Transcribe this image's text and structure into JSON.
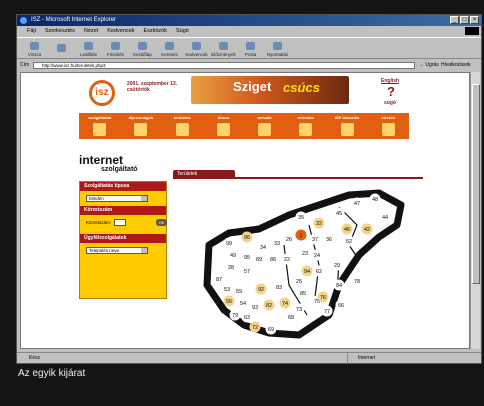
{
  "window": {
    "title": "ISZ - Microsoft Internet Explorer"
  },
  "menu": [
    "Fájl",
    "Szerkesztés",
    "Nézet",
    "Kedvencek",
    "Eszközök",
    "Súgó"
  ],
  "toolbar": [
    "Vissza",
    "",
    "Leállítás",
    "Frissítés",
    "Kezdőlap",
    "Keresés",
    "Kedvencek",
    "Előzmények",
    "Posta",
    "Nyomtatás"
  ],
  "address": {
    "label": "Cím",
    "value": "http://www.isz.hu/teruletek.php3",
    "go": "Ugrás",
    "links": "Hivatkozások"
  },
  "status": {
    "left": "Kész",
    "zone": "Internet"
  },
  "page": {
    "logo": "isz",
    "date_line1": "2001. szeptember 13.",
    "date_line2": "csütörtök",
    "banner_a": "Sziget",
    "banner_b": "csúcs",
    "english": "English",
    "help_mark": "?",
    "help_label": "súgó",
    "tabs": [
      "szolgáltatók",
      "díjcsomagok",
      "területek",
      "fórum",
      "netcafe",
      "referátor",
      "ISP dossziék",
      "hírekek"
    ],
    "brand_main": "internet",
    "brand_sub": "szolgáltató",
    "section_tab": "Területek",
    "side": {
      "h1": "Szolgáltatás típusa",
      "s1": "Minden",
      "h2": "Körzetszám",
      "field_label": "Körzetszám:",
      "ok": "OK",
      "h3": "Ügyfélszolgálatok",
      "s3": "Település neve"
    },
    "areas": [
      "47",
      "48",
      "45",
      "44",
      "35",
      "32",
      "46",
      "42",
      "99",
      "96",
      "34",
      "33",
      "26",
      "1",
      "37",
      "36",
      "52",
      "49",
      "95",
      "89",
      "88",
      "22",
      "23",
      "24",
      "28",
      "57",
      "94",
      "87",
      "25",
      "62",
      "29",
      "53",
      "59",
      "92",
      "83",
      "85",
      "84",
      "78",
      "56",
      "54",
      "93",
      "82",
      "74",
      "73",
      "75",
      "79",
      "63",
      "76",
      "77",
      "66",
      "72",
      "69",
      "68"
    ]
  },
  "caption": "Az egyik kijárat"
}
